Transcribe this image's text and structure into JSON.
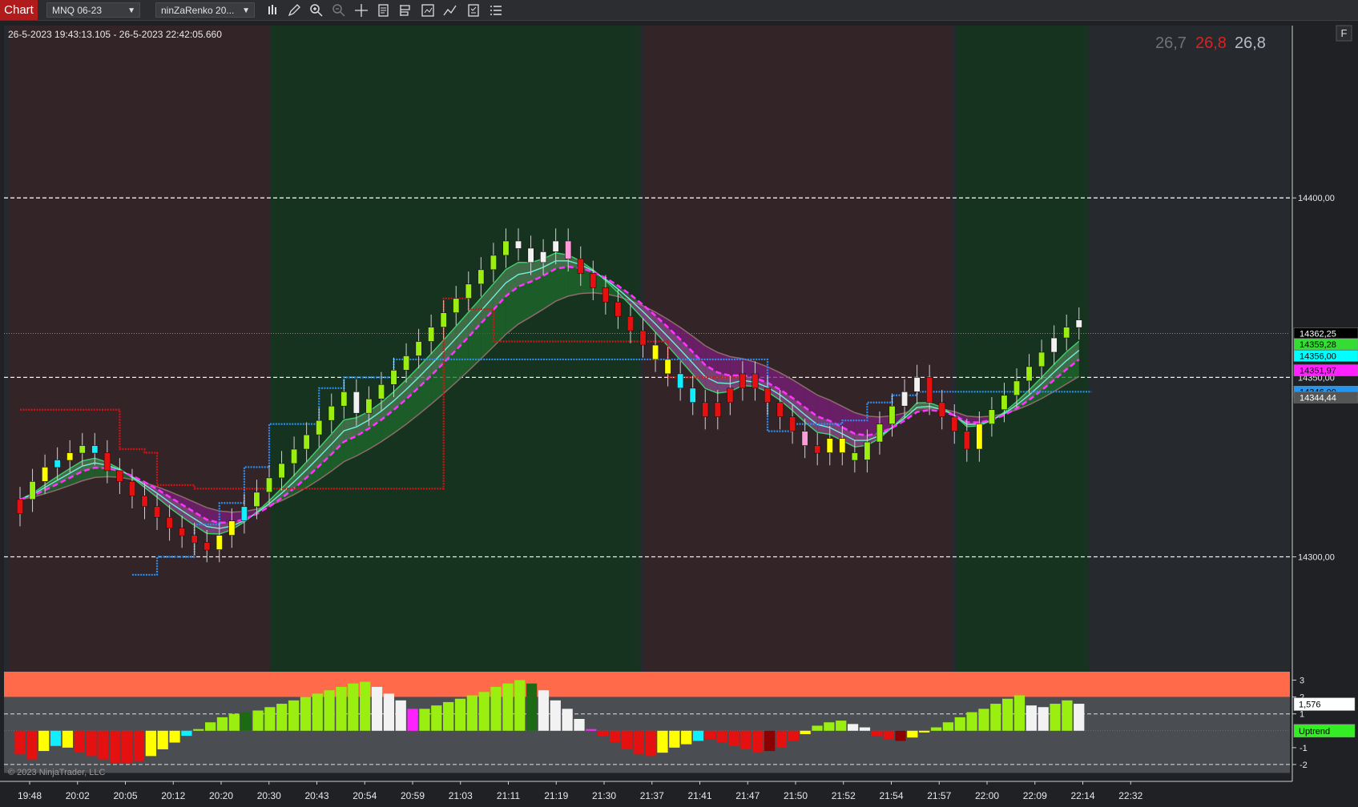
{
  "toolbar": {
    "chart_tab": "Chart",
    "instrument": "MNQ 06-23",
    "bar_type": "ninZaRenko 20...",
    "icons": [
      "bar-style-icon",
      "draw-pencil-icon",
      "zoom-in-icon",
      "zoom-out-icon",
      "crosshair-icon",
      "properties-icon",
      "data-box-icon",
      "strategy-icon",
      "indicator-icon",
      "template-icon",
      "list-icon"
    ]
  },
  "chart_header": {
    "date_range": "26-5-2023 19:43:13.105 - 26-5-2023 22:42:05.660",
    "stats": [
      {
        "text": "26,7",
        "color": "#6f7378"
      },
      {
        "text": "26,8",
        "color": "#e02020"
      },
      {
        "text": "26,8",
        "color": "#b8bcc2"
      }
    ],
    "f_button": "F"
  },
  "chart_data": {
    "type": "candlestick",
    "price_axis": {
      "ylim": [
        14268,
        14448
      ],
      "ticks": [
        {
          "value": 14400,
          "label": "14400,00"
        },
        {
          "value": 14300,
          "label": "14300,00"
        }
      ],
      "hidden_label": {
        "value": 14350,
        "label": "14350,00"
      }
    },
    "time_labels": [
      "19:48",
      "20:02",
      "20:05",
      "20:12",
      "20:20",
      "20:30",
      "20:43",
      "20:54",
      "20:59",
      "21:03",
      "21:11",
      "21:19",
      "21:30",
      "21:37",
      "21:41",
      "21:47",
      "21:50",
      "21:52",
      "21:54",
      "21:57",
      "22:00",
      "22:09",
      "22:14",
      "22:32"
    ],
    "price_flags": [
      {
        "label": "14362,25",
        "value": 14362.25,
        "bg": "#000000",
        "fg": "#ffffff"
      },
      {
        "label": "14359,28",
        "value": 14359.28,
        "bg": "#33dd33",
        "fg": "#000000"
      },
      {
        "label": "14356,00",
        "value": 14356.0,
        "bg": "#00ffff",
        "fg": "#000000"
      },
      {
        "label": "14351,97",
        "value": 14351.97,
        "bg": "#ff22ff",
        "fg": "#000000"
      },
      {
        "label": "14346,00",
        "value": 14346.0,
        "bg": "#2196f3",
        "fg": "#000000"
      },
      {
        "label": "14344,44",
        "value": 14344.44,
        "bg": "#555555",
        "fg": "#ffffff"
      }
    ],
    "background_zones": [
      {
        "from": 0,
        "to": 20,
        "trend": "down"
      },
      {
        "from": 21,
        "to": 49,
        "trend": "up"
      },
      {
        "from": 51,
        "to": 74,
        "trend": "down"
      },
      {
        "from": 76,
        "to": 85,
        "trend": "up"
      }
    ],
    "closes": [
      14316,
      14321,
      14325,
      14327,
      14329,
      14331,
      14329,
      14324,
      14321,
      14317,
      14314,
      14311,
      14308,
      14306,
      14304,
      14302,
      14306,
      14310,
      14314,
      14318,
      14322,
      14326,
      14330,
      14334,
      14338,
      14342,
      14346,
      14340,
      14344,
      14348,
      14352,
      14356,
      14360,
      14364,
      14368,
      14372,
      14376,
      14380,
      14384,
      14388,
      14386,
      14382,
      14385,
      14388,
      14383,
      14379,
      14375,
      14371,
      14367,
      14363,
      14359,
      14355,
      14351,
      14347,
      14343,
      14339,
      14343,
      14347,
      14351,
      14347,
      14343,
      14339,
      14335,
      14331,
      14329,
      14333,
      14329,
      14327,
      14332,
      14337,
      14342,
      14346,
      14350,
      14343,
      14339,
      14335,
      14330,
      14337,
      14341,
      14345,
      14349,
      14353,
      14357,
      14361,
      14364,
      14366
    ],
    "candle_colors": [
      "red",
      "yellowgreen",
      "yellow",
      "cyan",
      "yellow",
      "yellowgreen",
      "cyan",
      "red",
      "red",
      "red",
      "red",
      "red",
      "red",
      "red",
      "red",
      "red",
      "yellow",
      "yellow",
      "cyan",
      "yellowgreen",
      "yellowgreen",
      "yellowgreen",
      "yellowgreen",
      "yellowgreen",
      "yellowgreen",
      "yellowgreen",
      "yellowgreen",
      "white",
      "yellowgreen",
      "yellowgreen",
      "yellowgreen",
      "yellowgreen",
      "yellowgreen",
      "yellowgreen",
      "yellowgreen",
      "yellowgreen",
      "yellowgreen",
      "yellowgreen",
      "yellowgreen",
      "yellowgreen",
      "white",
      "white",
      "white",
      "white",
      "pink",
      "red",
      "red",
      "red",
      "red",
      "red",
      "red",
      "yellow",
      "yellow",
      "cyan",
      "cyan",
      "red",
      "red",
      "red",
      "red",
      "red",
      "red",
      "red",
      "red",
      "pink",
      "red",
      "yellow",
      "yellow",
      "yellowgreen",
      "yellowgreen",
      "yellowgreen",
      "yellowgreen",
      "white",
      "white",
      "red",
      "red",
      "red",
      "red",
      "yellow",
      "yellowgreen",
      "yellowgreen",
      "yellowgreen",
      "yellowgreen",
      "yellowgreen",
      "white",
      "yellowgreen",
      "white"
    ],
    "resistance_line": [
      [
        0,
        14341
      ],
      [
        5,
        14341
      ],
      [
        8,
        14330
      ],
      [
        10,
        14329
      ],
      [
        11,
        14320
      ],
      [
        12,
        14320
      ],
      [
        14,
        14319
      ],
      [
        34,
        14372
      ],
      [
        36,
        14369
      ],
      [
        38,
        14360
      ],
      [
        46,
        14360
      ],
      [
        52,
        14350
      ],
      [
        58,
        14350
      ]
    ],
    "support_line": [
      [
        9,
        14295
      ],
      [
        11,
        14300
      ],
      [
        14,
        14309
      ],
      [
        16,
        14315
      ],
      [
        18,
        14325
      ],
      [
        20,
        14337
      ],
      [
        24,
        14347
      ],
      [
        26,
        14350
      ],
      [
        30,
        14355
      ],
      [
        60,
        14335
      ],
      [
        62,
        14337
      ],
      [
        66,
        14338
      ],
      [
        68,
        14343
      ],
      [
        70,
        14345
      ],
      [
        72,
        14346
      ],
      [
        86,
        14346
      ]
    ],
    "oscillator": {
      "ylim": [
        -3,
        3.5
      ],
      "ticks": [
        {
          "value": 3,
          "label": "3"
        },
        {
          "value": 2,
          "label": "2"
        },
        {
          "value": 1,
          "label": "1"
        },
        {
          "value": -1,
          "label": "-1"
        },
        {
          "value": -2,
          "label": "-2"
        }
      ],
      "value_label": "1,576",
      "current_value": 1.576,
      "trend_label": "Uptrend",
      "values": [
        -1.4,
        -1.7,
        -1.2,
        -0.9,
        -1.0,
        -1.3,
        -1.5,
        -1.7,
        -1.9,
        -1.9,
        -1.8,
        -1.5,
        -1.1,
        -0.7,
        -0.3,
        0.1,
        0.5,
        0.8,
        1.0,
        1.1,
        1.2,
        1.4,
        1.6,
        1.8,
        2.0,
        2.2,
        2.4,
        2.6,
        2.8,
        2.9,
        2.6,
        2.2,
        1.8,
        1.3,
        1.3,
        1.5,
        1.7,
        1.9,
        2.1,
        2.3,
        2.6,
        2.8,
        3.0,
        2.8,
        2.4,
        1.8,
        1.3,
        0.7,
        0.1,
        -0.3,
        -0.7,
        -1.1,
        -1.4,
        -1.5,
        -1.3,
        -1.0,
        -0.8,
        -0.6,
        -0.5,
        -0.7,
        -0.9,
        -1.1,
        -1.3,
        -1.2,
        -1.0,
        -0.6,
        -0.2,
        0.3,
        0.5,
        0.6,
        0.4,
        0.2,
        -0.3,
        -0.5,
        -0.6,
        -0.4,
        -0.1,
        0.2,
        0.5,
        0.8,
        1.1,
        1.3,
        1.6,
        1.9,
        2.1,
        1.5,
        1.4,
        1.6,
        1.8,
        1.6
      ],
      "colors": [
        "red",
        "red",
        "yellow",
        "cyan",
        "yellow",
        "red",
        "red",
        "red",
        "red",
        "red",
        "red",
        "yellow",
        "yellow",
        "yellow",
        "cyan",
        "yellowgreen",
        "yellowgreen",
        "yellowgreen",
        "yellowgreen",
        "darkgreen",
        "yellowgreen",
        "yellowgreen",
        "yellowgreen",
        "yellowgreen",
        "yellowgreen",
        "yellowgreen",
        "yellowgreen",
        "yellowgreen",
        "yellowgreen",
        "yellowgreen",
        "white",
        "white",
        "white",
        "magenta",
        "yellowgreen",
        "yellowgreen",
        "yellowgreen",
        "yellowgreen",
        "yellowgreen",
        "yellowgreen",
        "yellowgreen",
        "yellowgreen",
        "yellowgreen",
        "darkgreen",
        "white",
        "white",
        "white",
        "white",
        "magenta",
        "red",
        "red",
        "red",
        "red",
        "red",
        "yellow",
        "yellow",
        "yellow",
        "cyan",
        "red",
        "red",
        "red",
        "red",
        "red",
        "darkred",
        "red",
        "red",
        "yellow",
        "yellowgreen",
        "yellowgreen",
        "yellowgreen",
        "white",
        "white",
        "red",
        "red",
        "darkred",
        "yellow",
        "yellow",
        "yellowgreen",
        "yellowgreen",
        "yellowgreen",
        "yellowgreen",
        "yellowgreen",
        "yellowgreen",
        "yellowgreen",
        "yellowgreen",
        "white",
        "white",
        "yellowgreen",
        "yellowgreen",
        "white"
      ]
    }
  },
  "footer": {
    "copyright": "© 2023 NinjaTrader, LLC"
  }
}
